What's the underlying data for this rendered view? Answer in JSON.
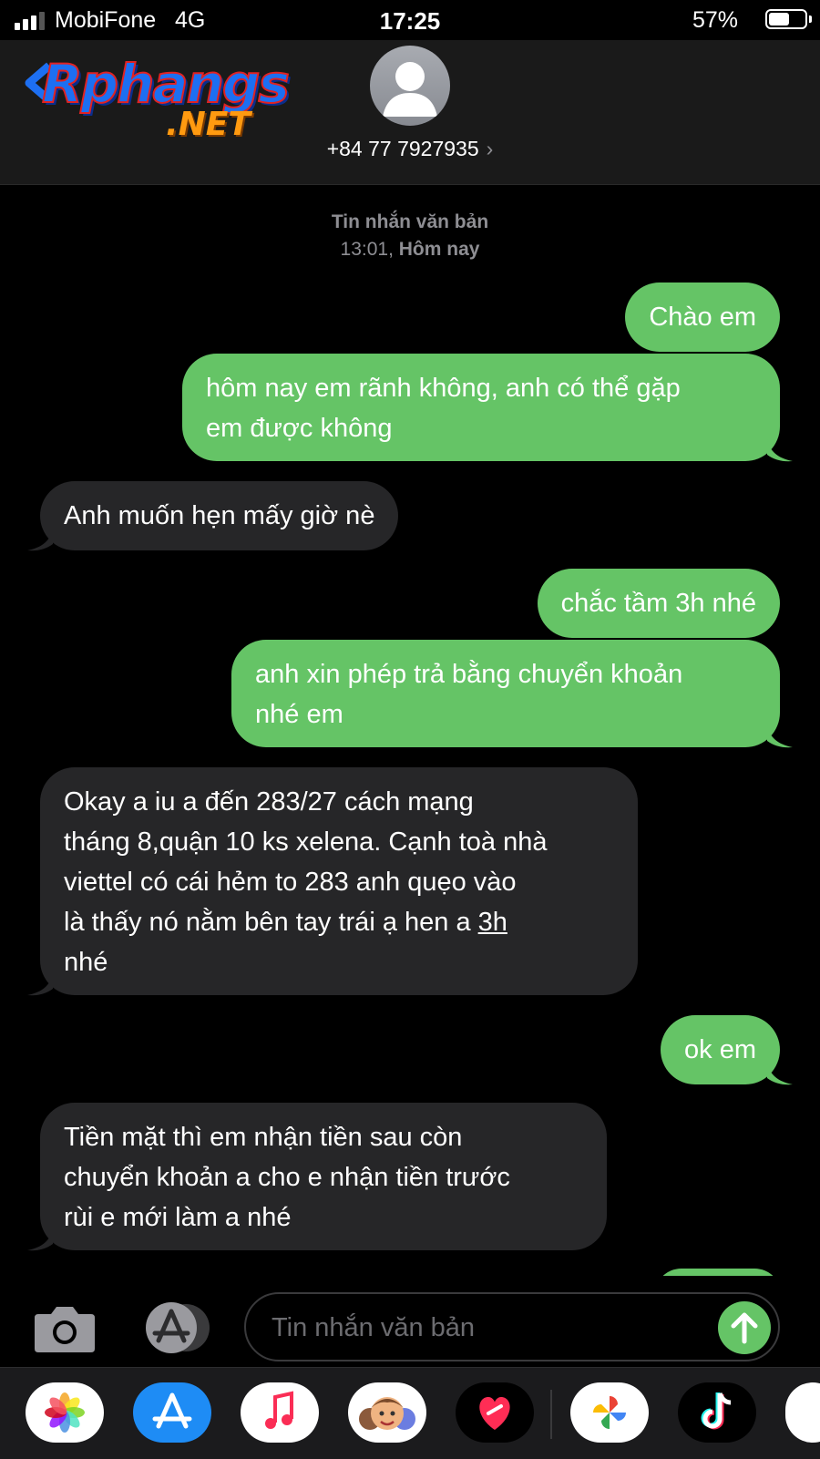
{
  "status": {
    "carrier": "MobiFone",
    "network": "4G",
    "time": "17:25",
    "battery": "57%",
    "battery_level": 0.57
  },
  "header": {
    "logo_main": "Rphangs",
    "logo_suffix": ".NET",
    "contact": "+84 77 7927935"
  },
  "thread": {
    "type_label": "Tin nhắn văn bản",
    "time": "13:01,",
    "day": "Hôm nay"
  },
  "messages": [
    {
      "dir": "sent",
      "text": "Chào em"
    },
    {
      "dir": "sent",
      "lines": [
        "hôm nay em rãnh không, anh có thể gặp",
        "em được không"
      ]
    },
    {
      "dir": "received",
      "text": "Anh muốn hẹn mấy giờ nè"
    },
    {
      "dir": "sent",
      "text": "chắc tầm 3h nhé"
    },
    {
      "dir": "sent",
      "lines": [
        "anh xin phép trả bằng chuyển khoản",
        "nhé em"
      ]
    },
    {
      "dir": "received",
      "lines": [
        "Okay a iu a đến 283/27 cách mạng",
        "tháng 8,quận 10 ks xelena. Cạnh toà nhà",
        "viettel có cái hẻm to 283 anh quẹo vào",
        "là thấy nó nằm bên tay trái ạ hen a ",
        "3h",
        "nhé"
      ]
    },
    {
      "dir": "sent",
      "text": "ok em"
    },
    {
      "dir": "received",
      "lines": [
        "Tiền mặt thì em nhận tiền sau còn",
        "chuyển khoản a cho e nhận tiền trước",
        "rùi e mới làm a nhé"
      ]
    }
  ],
  "composer": {
    "placeholder": "Tin nhắn văn bản"
  },
  "colors": {
    "sent_bubble": "#65c466",
    "received_bubble": "#262628",
    "background": "#000000"
  },
  "icons": [
    "camera-icon",
    "app-store-icon",
    "send-arrow-icon",
    "photos-icon",
    "music-icon",
    "memoji-icon",
    "health-icon",
    "google-photos-icon",
    "tiktok-icon"
  ]
}
